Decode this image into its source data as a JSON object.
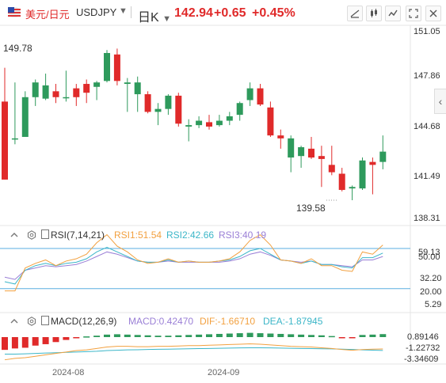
{
  "header": {
    "pair_name": "美元/日元",
    "symbol": "USDJPY",
    "caret": "▼",
    "period": "日K",
    "period_caret": "▼",
    "price": "142.94",
    "change": "+0.65",
    "change_pct": "+0.45%"
  },
  "toolbar": {
    "icons": [
      "draw-line-icon",
      "candle-style-icon",
      "indicator-icon",
      "fullscreen-icon",
      "close-icon"
    ],
    "side_toggle": "‹"
  },
  "main": {
    "high_label": "149.78",
    "low_label": "139.58",
    "axis_labels": [
      "151.05",
      "147.86",
      "144.68",
      "141.49",
      "138.31"
    ]
  },
  "rsi": {
    "label": "RSI(7,14,21)",
    "rsi1": "RSI1:51.54",
    "rsi2": "RSI2:42.66",
    "rsi3": "RSI3:40.19",
    "axis_labels": [
      "59.13",
      "50.00",
      "32.20",
      "20.00",
      "5.29"
    ]
  },
  "macd": {
    "label": "MACD(12,26,9)",
    "macd": "MACD:0.42470",
    "dif": "DIF:-1.66710",
    "dea": "DEA:-1.87945",
    "axis_labels": [
      "0.89146",
      "-1.22732",
      "-3.34609"
    ]
  },
  "xaxis": {
    "ticks": [
      "2024-08",
      "2024-09"
    ]
  },
  "colors": {
    "up": "#e02a2a",
    "down": "#2e9a5c",
    "rsi1": "#f2a03f",
    "rsi2": "#3cb6c8",
    "rsi3": "#9a7fd6",
    "dif": "#f2a03f",
    "dea": "#3cb6c8",
    "band": "#5aaee0"
  },
  "chart_data": {
    "type": "candlestick",
    "ylim": [
      138.31,
      151.05
    ],
    "candles": [
      {
        "o": 141.0,
        "h": 148.6,
        "l": 141.0,
        "c": 146.3,
        "dir": "up"
      },
      {
        "o": 143.8,
        "h": 147.6,
        "l": 143.4,
        "c": 143.8,
        "dir": "down"
      },
      {
        "o": 143.9,
        "h": 147.0,
        "l": 143.9,
        "c": 146.6,
        "dir": "down"
      },
      {
        "o": 146.6,
        "h": 147.8,
        "l": 146.0,
        "c": 147.6,
        "dir": "down"
      },
      {
        "o": 146.5,
        "h": 148.2,
        "l": 146.4,
        "c": 147.4,
        "dir": "down"
      },
      {
        "o": 146.6,
        "h": 147.5,
        "l": 146.2,
        "c": 147.0,
        "dir": "up"
      },
      {
        "o": 146.6,
        "h": 148.4,
        "l": 146.3,
        "c": 146.6,
        "dir": "down"
      },
      {
        "o": 146.6,
        "h": 147.5,
        "l": 146.0,
        "c": 147.2,
        "dir": "up"
      },
      {
        "o": 146.9,
        "h": 147.8,
        "l": 146.2,
        "c": 147.5,
        "dir": "up"
      },
      {
        "o": 147.3,
        "h": 147.7,
        "l": 146.4,
        "c": 147.6,
        "dir": "down"
      },
      {
        "o": 147.7,
        "h": 149.8,
        "l": 147.6,
        "c": 149.6,
        "dir": "down"
      },
      {
        "o": 149.5,
        "h": 149.9,
        "l": 147.4,
        "c": 147.7,
        "dir": "up"
      },
      {
        "o": 147.6,
        "h": 147.9,
        "l": 145.6,
        "c": 147.5,
        "dir": "down"
      },
      {
        "o": 147.6,
        "h": 148.0,
        "l": 145.6,
        "c": 146.8,
        "dir": "down"
      },
      {
        "o": 146.8,
        "h": 147.0,
        "l": 145.5,
        "c": 145.6,
        "dir": "up"
      },
      {
        "o": 145.6,
        "h": 146.2,
        "l": 144.7,
        "c": 145.8,
        "dir": "down"
      },
      {
        "o": 145.8,
        "h": 146.8,
        "l": 145.4,
        "c": 146.7,
        "dir": "down"
      },
      {
        "o": 146.7,
        "h": 146.9,
        "l": 144.6,
        "c": 144.8,
        "dir": "up"
      },
      {
        "o": 144.7,
        "h": 145.1,
        "l": 143.6,
        "c": 144.6,
        "dir": "down"
      },
      {
        "o": 144.7,
        "h": 145.3,
        "l": 144.5,
        "c": 145.0,
        "dir": "down"
      },
      {
        "o": 144.9,
        "h": 145.4,
        "l": 144.4,
        "c": 144.6,
        "dir": "up"
      },
      {
        "o": 144.7,
        "h": 145.4,
        "l": 144.6,
        "c": 145.0,
        "dir": "down"
      },
      {
        "o": 145.0,
        "h": 145.6,
        "l": 144.7,
        "c": 145.3,
        "dir": "down"
      },
      {
        "o": 145.4,
        "h": 146.3,
        "l": 145.0,
        "c": 146.2,
        "dir": "down"
      },
      {
        "o": 146.4,
        "h": 147.6,
        "l": 146.0,
        "c": 147.2,
        "dir": "down"
      },
      {
        "o": 147.2,
        "h": 147.5,
        "l": 146.0,
        "c": 146.1,
        "dir": "up"
      },
      {
        "o": 145.9,
        "h": 146.3,
        "l": 143.9,
        "c": 144.0,
        "dir": "up"
      },
      {
        "o": 144.0,
        "h": 144.4,
        "l": 143.1,
        "c": 143.8,
        "dir": "up"
      },
      {
        "o": 143.8,
        "h": 144.0,
        "l": 141.5,
        "c": 142.5,
        "dir": "down"
      },
      {
        "o": 142.6,
        "h": 143.3,
        "l": 141.8,
        "c": 143.2,
        "dir": "down"
      },
      {
        "o": 143.1,
        "h": 143.9,
        "l": 142.4,
        "c": 142.5,
        "dir": "up"
      },
      {
        "o": 142.6,
        "h": 143.3,
        "l": 140.5,
        "c": 142.4,
        "dir": "up"
      },
      {
        "o": 142.0,
        "h": 143.3,
        "l": 141.3,
        "c": 141.5,
        "dir": "up"
      },
      {
        "o": 141.4,
        "h": 141.8,
        "l": 140.2,
        "c": 140.3,
        "dir": "up"
      },
      {
        "o": 140.5,
        "h": 140.6,
        "l": 139.6,
        "c": 140.4,
        "dir": "down"
      },
      {
        "o": 140.4,
        "h": 142.5,
        "l": 140.3,
        "c": 142.3,
        "dir": "down"
      },
      {
        "o": 142.2,
        "h": 142.5,
        "l": 140.0,
        "c": 142.0,
        "dir": "up"
      },
      {
        "o": 142.2,
        "h": 144.0,
        "l": 141.7,
        "c": 142.9,
        "dir": "down"
      }
    ],
    "rsi_ylim": [
      5.29,
      59.13
    ],
    "rsi_bands": [
      55,
      20
    ],
    "rsi1": [
      18,
      18,
      38,
      42,
      45,
      40,
      44,
      46,
      50,
      60,
      67,
      57,
      52,
      45,
      42,
      43,
      46,
      43,
      44,
      43,
      43,
      44,
      46,
      52,
      62,
      67,
      58,
      45,
      44,
      42,
      46,
      40,
      40,
      36,
      35,
      52,
      50,
      58
    ],
    "rsi2": [
      26,
      24,
      36,
      40,
      42,
      40,
      42,
      43,
      46,
      52,
      56,
      52,
      48,
      44,
      43,
      43,
      45,
      43,
      44,
      43,
      43,
      44,
      45,
      48,
      53,
      55,
      50,
      45,
      44,
      42,
      44,
      41,
      41,
      39,
      38,
      47,
      47,
      51
    ],
    "rsi3": [
      30,
      28,
      36,
      38,
      40,
      39,
      40,
      41,
      44,
      48,
      52,
      50,
      47,
      44,
      43,
      43,
      44,
      43,
      43,
      43,
      43,
      43,
      44,
      46,
      50,
      52,
      49,
      45,
      44,
      43,
      44,
      41,
      41,
      40,
      39,
      45,
      45,
      48
    ],
    "macd_ylim": [
      -3.34609,
      0.89146
    ],
    "macd_hist": [
      -1.8,
      -1.6,
      -1.5,
      -1.2,
      -1.0,
      -0.7,
      -0.4,
      -0.15,
      0.1,
      0.2,
      0.35,
      0.4,
      0.35,
      0.3,
      0.25,
      0.2,
      0.2,
      0.25,
      0.3,
      0.35,
      0.4,
      0.45,
      0.5,
      0.55,
      0.6,
      0.55,
      0.5,
      0.45,
      0.4,
      0.35,
      0.3,
      0.25,
      0.15,
      -0.1,
      -0.15,
      0.3,
      0.35,
      0.42
    ],
    "dif": [
      -3.2,
      -3.0,
      -2.9,
      -2.7,
      -2.5,
      -2.3,
      -2.1,
      -1.9,
      -1.8,
      -1.6,
      -1.4,
      -1.3,
      -1.3,
      -1.35,
      -1.35,
      -1.3,
      -1.3,
      -1.25,
      -1.2,
      -1.2,
      -1.15,
      -1.1,
      -1.05,
      -1.0,
      -0.95,
      -1.0,
      -1.1,
      -1.2,
      -1.3,
      -1.35,
      -1.4,
      -1.5,
      -1.6,
      -1.75,
      -1.85,
      -1.75,
      -1.7,
      -1.67
    ],
    "dea": [
      -2.4,
      -2.4,
      -2.35,
      -2.3,
      -2.25,
      -2.2,
      -2.15,
      -2.1,
      -2.05,
      -2.0,
      -1.9,
      -1.85,
      -1.8,
      -1.78,
      -1.75,
      -1.72,
      -1.7,
      -1.68,
      -1.65,
      -1.62,
      -1.6,
      -1.58,
      -1.55,
      -1.52,
      -1.5,
      -1.5,
      -1.52,
      -1.55,
      -1.58,
      -1.6,
      -1.62,
      -1.64,
      -1.66,
      -1.7,
      -1.75,
      -1.8,
      -1.84,
      -1.88
    ]
  }
}
